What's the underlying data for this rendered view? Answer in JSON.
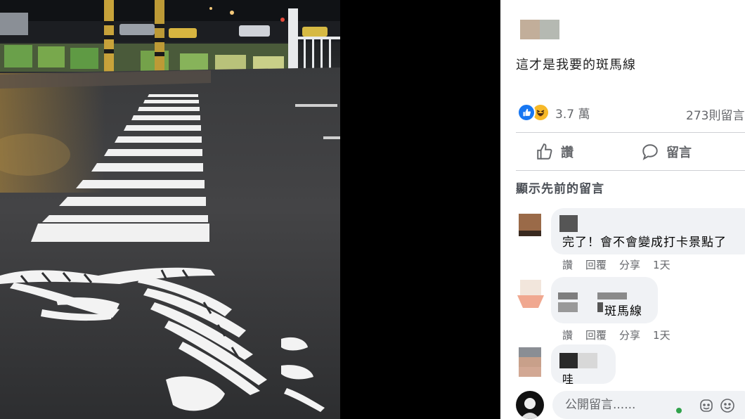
{
  "post": {
    "text": "這才是我要的斑馬線",
    "reaction_count": "3.7 萬",
    "comment_count": "273則留言",
    "reactions": [
      "like-icon",
      "haha-icon"
    ]
  },
  "actions": {
    "like_label": "讚",
    "comment_label": "留言"
  },
  "comments_section": {
    "show_previous": "顯示先前的留言"
  },
  "comments": [
    {
      "text": "完了！會不會變成打卡景點了",
      "like": "讚",
      "reply": "回覆",
      "share": "分享",
      "time": "1天"
    },
    {
      "text": "斑馬線",
      "like": "讚",
      "reply": "回覆",
      "share": "分享",
      "time": "1天"
    },
    {
      "text": "哇"
    }
  ],
  "composer": {
    "placeholder": "公開留言......"
  },
  "colors": {
    "facebook_blue": "#1877f2",
    "muted_text": "#65676b",
    "bubble_bg": "#f0f2f5"
  }
}
